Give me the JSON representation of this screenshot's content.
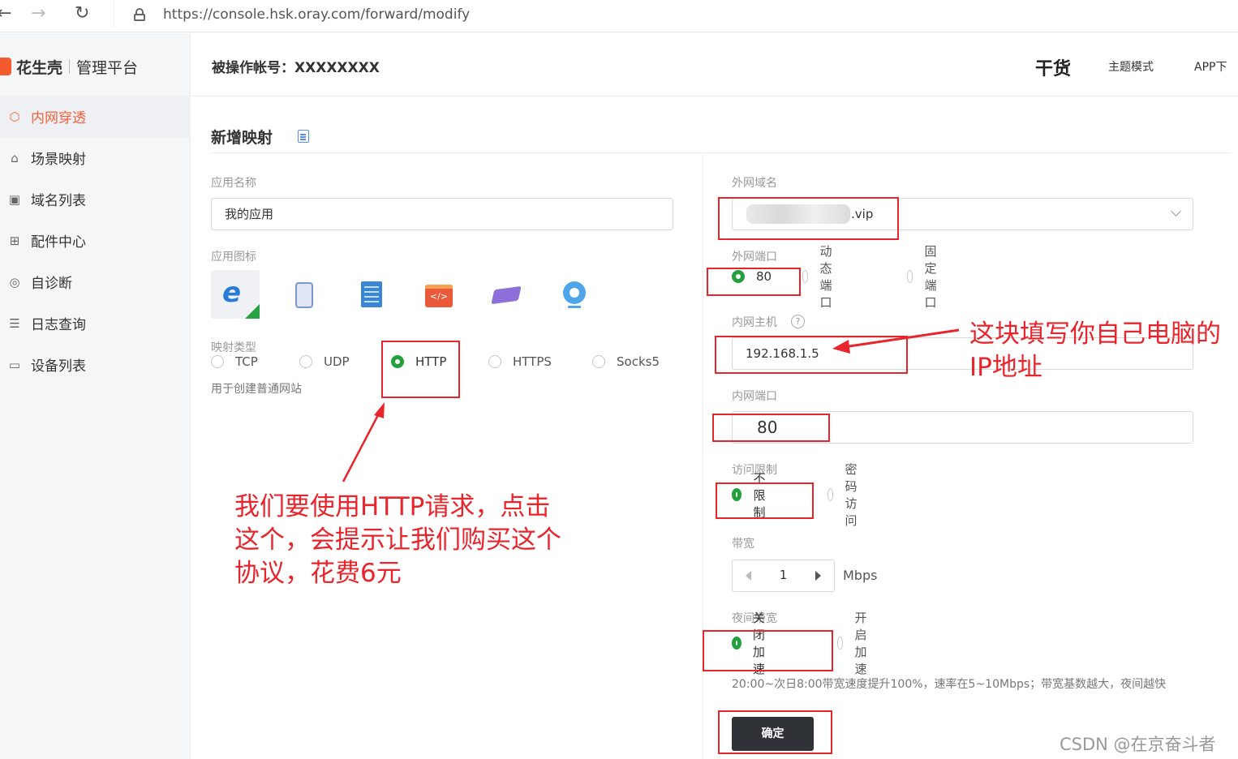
{
  "browser": {
    "url": "https://console.hsk.oray.com/forward/modify",
    "back_glyph": "←",
    "forward_glyph": "→",
    "refresh_glyph": "↻"
  },
  "sidebar": {
    "brand": "花生壳",
    "brand_sub": "管理平台",
    "items": [
      {
        "label": "内网穿透",
        "icon": "cube-icon",
        "glyph": "⬡"
      },
      {
        "label": "场景映射",
        "icon": "home-icon",
        "glyph": "⌂"
      },
      {
        "label": "域名列表",
        "icon": "domain-icon",
        "glyph": "▣"
      },
      {
        "label": "配件中心",
        "icon": "grid-icon",
        "glyph": "⊞"
      },
      {
        "label": "自诊断",
        "icon": "diagnose-icon",
        "glyph": "◎"
      },
      {
        "label": "日志查询",
        "icon": "log-icon",
        "glyph": "☰"
      },
      {
        "label": "设备列表",
        "icon": "monitor-icon",
        "glyph": "▭"
      }
    ]
  },
  "header": {
    "account": "被操作帐号：XXXXXXXX",
    "brand": "干货",
    "theme_mode": "主题模式",
    "app_download": "APP下"
  },
  "form": {
    "title": "新增映射",
    "app_name_label": "应用名称",
    "app_name_value": "我的应用",
    "app_icon_label": "应用图标",
    "mapping_type_label": "映射类型",
    "mapping_types": [
      "TCP",
      "UDP",
      "HTTP",
      "HTTPS",
      "Socks5"
    ],
    "mapping_type_selected": "HTTP",
    "mapping_hint": "用于创建普通网站",
    "domain_label": "外网域名",
    "domain_value": ".vip",
    "ext_port_label": "外网端口",
    "ext_port_options": [
      "80",
      "动态端口",
      "固定端口"
    ],
    "host_label": "内网主机",
    "host_help": "?",
    "host_value": "192.168.1.5",
    "int_port_label": "内网端口",
    "int_port_value": "80",
    "access_label": "访问限制",
    "access_options": [
      "不限制",
      "密码访问"
    ],
    "bandwidth_label": "带宽",
    "bandwidth_value": "1",
    "bandwidth_unit": "Mbps",
    "night_label": "夜间带宽",
    "night_options": [
      "关闭加速",
      "开启加速"
    ],
    "night_hint": "20:00~次日8:00带宽速度提升100%，速率在5~10Mbps；带宽基数越大，夜间越快",
    "submit": "确定"
  },
  "annotations": {
    "left_lines": [
      "我们要使用HTTP请求，点击",
      "这个，会提示让我们购买这个",
      "协议，花费6元"
    ],
    "right_lines": [
      "这块填写你自己电脑的",
      "IP地址"
    ],
    "color": "#e8242c"
  },
  "watermark": "CSDN @在京奋斗者",
  "colors": {
    "accent": "#f0623d",
    "radio_on": "#22a03c",
    "button": "#2f3337"
  }
}
